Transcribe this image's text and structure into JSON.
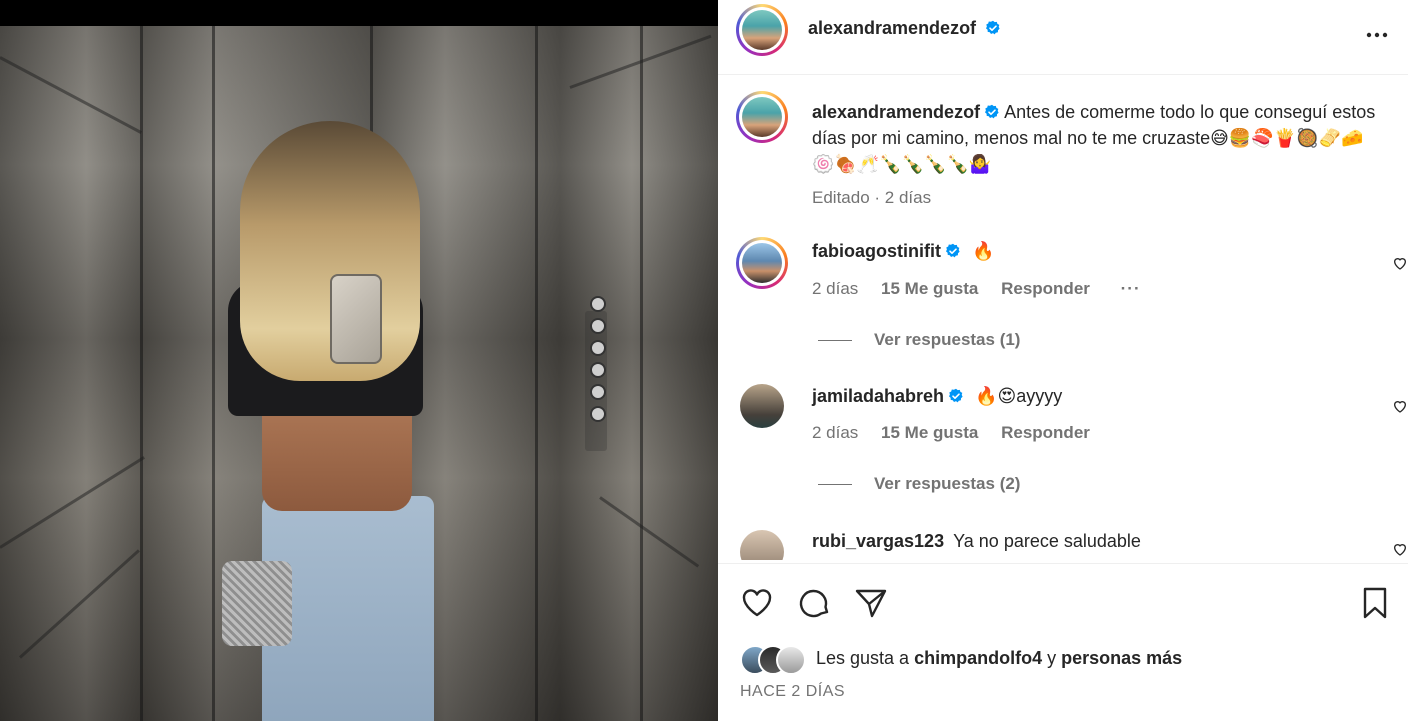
{
  "post": {
    "author": "alexandramendezof",
    "caption_text": "Antes de comerme todo lo que conseguí estos días por mi camino, menos mal no te me cruzaste😅🍔🍣🍟🥘🫔🧀🍥🍖🥂🍾🍾🍾🍾🤷‍♀️",
    "caption_meta": "Editado · 2 días"
  },
  "comments": [
    {
      "username": "fabioagostinifit",
      "verified": true,
      "text": "🔥",
      "time": "2 días",
      "likes": "15 Me gusta",
      "reply_label": "Responder",
      "more": "···",
      "view_replies": "Ver respuestas (1)"
    },
    {
      "username": "jamiladahabreh",
      "verified": true,
      "text": "🔥😍ayyyy",
      "time": "2 días",
      "likes": "15 Me gusta",
      "reply_label": "Responder",
      "view_replies": "Ver respuestas (2)"
    },
    {
      "username": "rubi_vargas123",
      "verified": false,
      "text": "Ya no parece saludable"
    }
  ],
  "likes": {
    "prefix": "Les gusta a ",
    "user": "chimpandolfo4",
    "middle": " y ",
    "others": "personas más"
  },
  "timestamp": "HACE 2 DÍAS",
  "colors": {
    "verified": "#0095f6",
    "text": "#262626",
    "secondary": "#737373"
  },
  "icons": {
    "like": "heart-icon",
    "comment": "comment-icon",
    "share": "send-icon",
    "save": "bookmark-icon",
    "more": "more-options-icon"
  }
}
